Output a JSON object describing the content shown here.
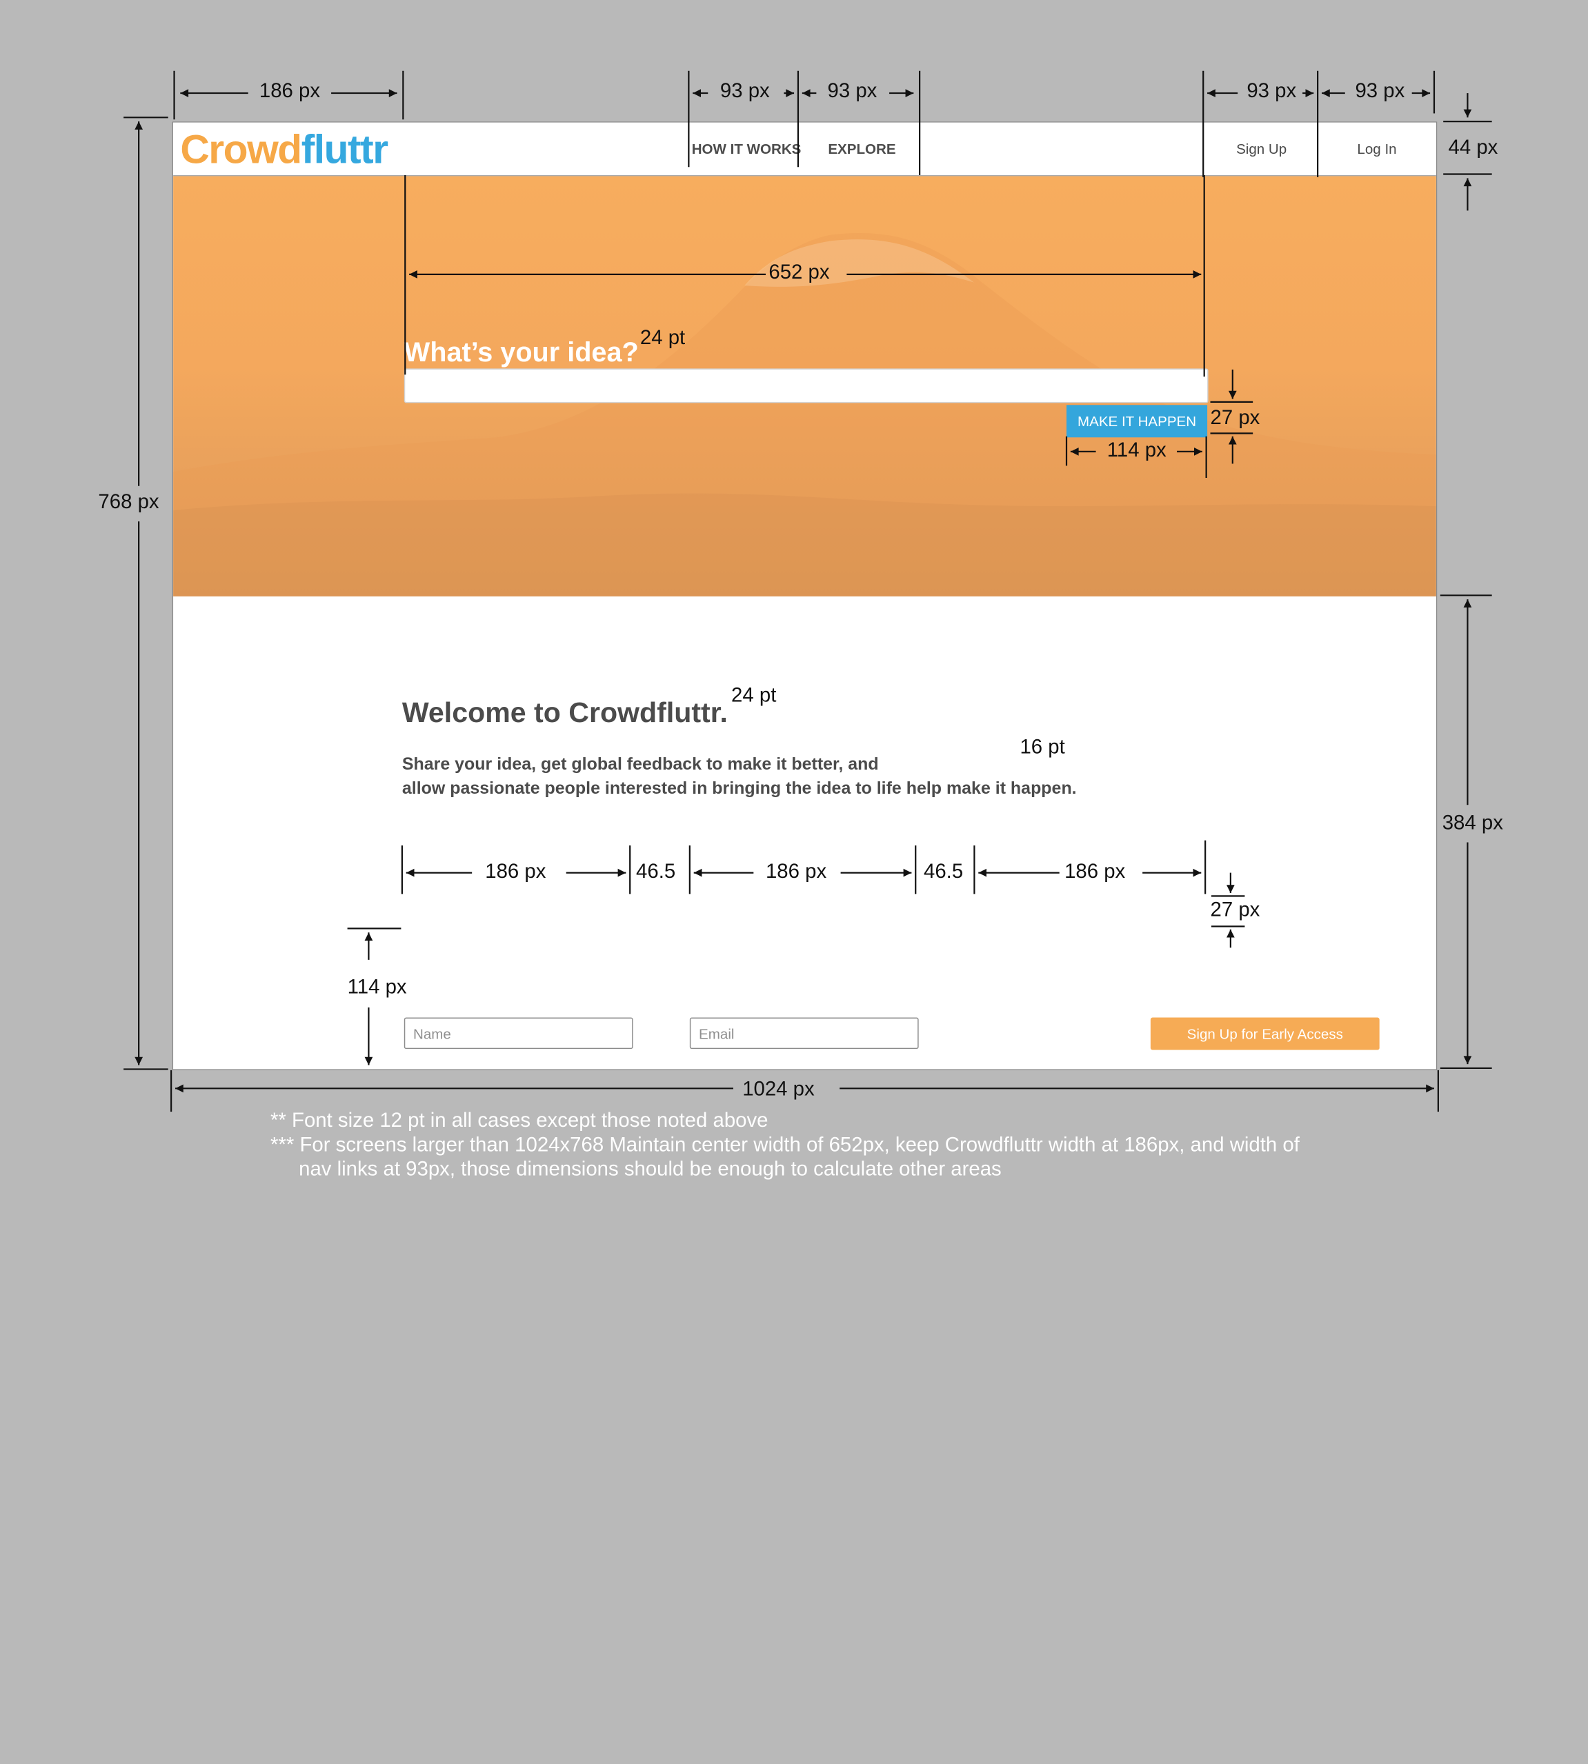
{
  "header": {
    "logo": {
      "left": "Cr",
      "mid": "owd",
      "right": "fluttr"
    },
    "nav": [
      {
        "label": "HOW IT WORKS"
      },
      {
        "label": "EXPLORE"
      }
    ],
    "auth": [
      {
        "label": "Sign Up"
      },
      {
        "label": "Log In"
      }
    ]
  },
  "hero": {
    "title": "What’s your idea?",
    "input_value": "",
    "button": "MAKE IT HAPPEN"
  },
  "welcome": {
    "title": "Welcome to Crowdfluttr.",
    "line1": "Share your idea, get global feedback to make it better, and",
    "line2": "allow passionate people interested in bringing the idea to life help make it happen.",
    "name_placeholder": "Name",
    "email_placeholder": "Email",
    "signup_button": "Sign Up for Early Access"
  },
  "annotations": {
    "top_left": "186 px",
    "top_mid1": "93 px",
    "top_mid2": "93 px",
    "top_right1": "93 px",
    "top_right2": "93 px",
    "header_height": "44 px",
    "hero_width": "652 px",
    "title_size": "24 pt",
    "button_height": "27 px",
    "button_width": "114 px",
    "page_height": "768 px",
    "welcome_size": "24 pt",
    "desc_size": "16 pt",
    "name_width": "186 px",
    "gap1": "46.5",
    "email_width": "186 px",
    "gap2": "46.5",
    "signup_width": "186 px",
    "signup_height": "27 px",
    "bottom_gap": "114 px",
    "lower_height": "384 px",
    "page_width": "1024 px",
    "note1": "** Font size 12 pt in all cases except those noted above",
    "note2": "*** For screens larger than 1024x768 Maintain center width of 652px, keep Crowdfluttr width at 186px, and width of",
    "note3": "nav links at 93px, those dimensions should be enough to calculate other areas"
  }
}
